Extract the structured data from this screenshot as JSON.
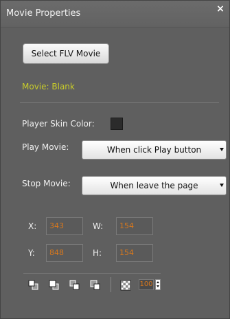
{
  "panel": {
    "title": "Movie Properties",
    "close_glyph": "×"
  },
  "movie": {
    "select_button_label": "Select FLV Movie",
    "status_text": "Movie: Blank"
  },
  "skin": {
    "label": "Player Skin Color:",
    "color": "#2b2b2b"
  },
  "play": {
    "label": "Play Movie:",
    "selected": "When click Play button"
  },
  "stop": {
    "label": "Stop Movie:",
    "selected": "When leave the page"
  },
  "position": {
    "x_label": "X:",
    "x_value": "343",
    "y_label": "Y:",
    "y_value": "848",
    "w_label": "W:",
    "w_value": "154",
    "h_label": "H:",
    "h_value": "154"
  },
  "toolbar": {
    "icons": [
      "bring-to-front-icon",
      "bring-forward-icon",
      "send-backward-icon",
      "send-to-back-icon",
      "opacity-checker-icon"
    ],
    "opacity_value": "100"
  },
  "colors": {
    "panel_bg": "#5f5f5f",
    "status_text": "#c8cc2a",
    "value_text": "#d9781c"
  }
}
